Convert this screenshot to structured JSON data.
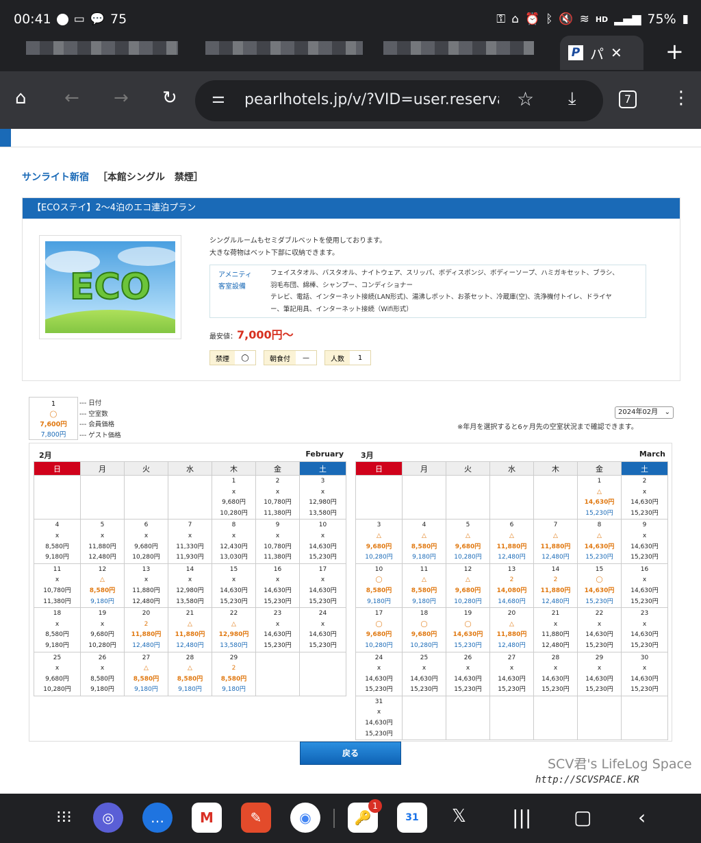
{
  "status": {
    "time": "00:41",
    "notif_count": "75",
    "battery": "75%",
    "hd": "HD"
  },
  "tab": {
    "title": "パ",
    "fav": "P",
    "close": "✕",
    "new": "+"
  },
  "toolbar": {
    "url": "pearlhotels.jp/v/?VID=user.reservat",
    "tabs": "7"
  },
  "hotel": {
    "name": "サンライト新宿",
    "room": "［本館シングル　禁煙］"
  },
  "plan": {
    "title": "【ECOステイ】2〜4泊のエコ連泊プラン",
    "image_text": "ECO",
    "desc1": "シングルルームもセミダブルベットを使用しております。",
    "desc2": "大きな荷物はベット下部に収納できます。",
    "amen_label1": "アメニティ",
    "amen_label2": "客室設備",
    "amen_line1": "フェイスタオル、バスタオル、ナイトウェア、スリッパ、ボディスポンジ、ボディーソープ、ハミガキセット、ブラシ、",
    "amen_line2": "羽毛布団、綿棒、シャンプー、コンディショナー",
    "amen_line3": "テレビ、電話、インターネット接続(LAN形式)、湯沸しポット、お茶セット、冷蔵庫(空)、洗浄機付トイレ、ドライヤ",
    "amen_line4": "ー、筆記用具、インターネット接続（Wifi形式）",
    "price_label": "最安値：",
    "price": "7,000円〜",
    "tags": [
      {
        "k": "禁煙",
        "v": "◯"
      },
      {
        "k": "朝食付",
        "v": "—"
      },
      {
        "k": "人数",
        "v": "1"
      }
    ]
  },
  "legend": {
    "day": "1",
    "avail": "◯",
    "member": "7,600円",
    "guest": "7,800円",
    "l1": "--- 日付",
    "l2": "--- 空室数",
    "l3": "--- 会員価格",
    "l4": "--- ゲスト価格"
  },
  "month_select": "2024年02月",
  "note": "※年月を選択すると6ヶ月先の空室状況まで確認できます。",
  "weekdays": [
    "日",
    "月",
    "火",
    "水",
    "木",
    "金",
    "土"
  ],
  "calendars": [
    {
      "ja": "2月",
      "en": "February",
      "weeks": [
        [
          null,
          null,
          null,
          null,
          {
            "d": "1",
            "a": "x",
            "m": "9,680円",
            "g": "10,280円",
            "o": false
          },
          {
            "d": "2",
            "a": "x",
            "m": "10,780円",
            "g": "11,380円",
            "o": false
          },
          {
            "d": "3",
            "a": "x",
            "m": "12,980円",
            "g": "13,580円",
            "o": false
          }
        ],
        [
          {
            "d": "4",
            "a": "x",
            "m": "8,580円",
            "g": "9,180円",
            "o": false
          },
          {
            "d": "5",
            "a": "x",
            "m": "11,880円",
            "g": "12,480円",
            "o": false
          },
          {
            "d": "6",
            "a": "x",
            "m": "9,680円",
            "g": "10,280円",
            "o": false
          },
          {
            "d": "7",
            "a": "x",
            "m": "11,330円",
            "g": "11,930円",
            "o": false
          },
          {
            "d": "8",
            "a": "x",
            "m": "12,430円",
            "g": "13,030円",
            "o": false
          },
          {
            "d": "9",
            "a": "x",
            "m": "10,780円",
            "g": "11,380円",
            "o": false
          },
          {
            "d": "10",
            "a": "x",
            "m": "14,630円",
            "g": "15,230円",
            "o": false
          }
        ],
        [
          {
            "d": "11",
            "a": "x",
            "m": "10,780円",
            "g": "11,380円",
            "o": false
          },
          {
            "d": "12",
            "a": "△",
            "m": "8,580円",
            "g": "9,180円",
            "o": true
          },
          {
            "d": "13",
            "a": "x",
            "m": "11,880円",
            "g": "12,480円",
            "o": false
          },
          {
            "d": "14",
            "a": "x",
            "m": "12,980円",
            "g": "13,580円",
            "o": false
          },
          {
            "d": "15",
            "a": "x",
            "m": "14,630円",
            "g": "15,230円",
            "o": false
          },
          {
            "d": "16",
            "a": "x",
            "m": "14,630円",
            "g": "15,230円",
            "o": false
          },
          {
            "d": "17",
            "a": "x",
            "m": "14,630円",
            "g": "15,230円",
            "o": false
          }
        ],
        [
          {
            "d": "18",
            "a": "x",
            "m": "8,580円",
            "g": "9,180円",
            "o": false
          },
          {
            "d": "19",
            "a": "x",
            "m": "9,680円",
            "g": "10,280円",
            "o": false
          },
          {
            "d": "20",
            "a": "2",
            "m": "11,880円",
            "g": "12,480円",
            "o": true
          },
          {
            "d": "21",
            "a": "△",
            "m": "11,880円",
            "g": "12,480円",
            "o": true
          },
          {
            "d": "22",
            "a": "△",
            "m": "12,980円",
            "g": "13,580円",
            "o": true
          },
          {
            "d": "23",
            "a": "x",
            "m": "14,630円",
            "g": "15,230円",
            "o": false
          },
          {
            "d": "24",
            "a": "x",
            "m": "14,630円",
            "g": "15,230円",
            "o": false
          }
        ],
        [
          {
            "d": "25",
            "a": "x",
            "m": "9,680円",
            "g": "10,280円",
            "o": false
          },
          {
            "d": "26",
            "a": "x",
            "m": "8,580円",
            "g": "9,180円",
            "o": false
          },
          {
            "d": "27",
            "a": "△",
            "m": "8,580円",
            "g": "9,180円",
            "o": true
          },
          {
            "d": "28",
            "a": "△",
            "m": "8,580円",
            "g": "9,180円",
            "o": true
          },
          {
            "d": "29",
            "a": "2",
            "m": "8,580円",
            "g": "9,180円",
            "o": true
          },
          null,
          null
        ]
      ]
    },
    {
      "ja": "3月",
      "en": "March",
      "weeks": [
        [
          null,
          null,
          null,
          null,
          null,
          {
            "d": "1",
            "a": "△",
            "m": "14,630円",
            "g": "15,230円",
            "o": true
          },
          {
            "d": "2",
            "a": "x",
            "m": "14,630円",
            "g": "15,230円",
            "o": false
          }
        ],
        [
          {
            "d": "3",
            "a": "△",
            "m": "9,680円",
            "g": "10,280円",
            "o": true
          },
          {
            "d": "4",
            "a": "△",
            "m": "8,580円",
            "g": "9,180円",
            "o": true
          },
          {
            "d": "5",
            "a": "△",
            "m": "9,680円",
            "g": "10,280円",
            "o": true
          },
          {
            "d": "6",
            "a": "△",
            "m": "11,880円",
            "g": "12,480円",
            "o": true
          },
          {
            "d": "7",
            "a": "△",
            "m": "11,880円",
            "g": "12,480円",
            "o": true
          },
          {
            "d": "8",
            "a": "△",
            "m": "14,630円",
            "g": "15,230円",
            "o": true
          },
          {
            "d": "9",
            "a": "x",
            "m": "14,630円",
            "g": "15,230円",
            "o": false
          }
        ],
        [
          {
            "d": "10",
            "a": "◯",
            "m": "8,580円",
            "g": "9,180円",
            "o": true
          },
          {
            "d": "11",
            "a": "△",
            "m": "8,580円",
            "g": "9,180円",
            "o": true
          },
          {
            "d": "12",
            "a": "△",
            "m": "9,680円",
            "g": "10,280円",
            "o": true
          },
          {
            "d": "13",
            "a": "2",
            "m": "14,080円",
            "g": "14,680円",
            "o": true
          },
          {
            "d": "14",
            "a": "2",
            "m": "11,880円",
            "g": "12,480円",
            "o": true
          },
          {
            "d": "15",
            "a": "◯",
            "m": "14,630円",
            "g": "15,230円",
            "o": true
          },
          {
            "d": "16",
            "a": "x",
            "m": "14,630円",
            "g": "15,230円",
            "o": false
          }
        ],
        [
          {
            "d": "17",
            "a": "◯",
            "m": "9,680円",
            "g": "10,280円",
            "o": true
          },
          {
            "d": "18",
            "a": "◯",
            "m": "9,680円",
            "g": "10,280円",
            "o": true
          },
          {
            "d": "19",
            "a": "◯",
            "m": "14,630円",
            "g": "15,230円",
            "o": true
          },
          {
            "d": "20",
            "a": "△",
            "m": "11,880円",
            "g": "12,480円",
            "o": true
          },
          {
            "d": "21",
            "a": "x",
            "m": "11,880円",
            "g": "12,480円",
            "o": false
          },
          {
            "d": "22",
            "a": "x",
            "m": "14,630円",
            "g": "15,230円",
            "o": false
          },
          {
            "d": "23",
            "a": "x",
            "m": "14,630円",
            "g": "15,230円",
            "o": false
          }
        ],
        [
          {
            "d": "24",
            "a": "x",
            "m": "14,630円",
            "g": "15,230円",
            "o": false
          },
          {
            "d": "25",
            "a": "x",
            "m": "14,630円",
            "g": "15,230円",
            "o": false
          },
          {
            "d": "26",
            "a": "x",
            "m": "14,630円",
            "g": "15,230円",
            "o": false
          },
          {
            "d": "27",
            "a": "x",
            "m": "14,630円",
            "g": "15,230円",
            "o": false
          },
          {
            "d": "28",
            "a": "x",
            "m": "14,630円",
            "g": "15,230円",
            "o": false
          },
          {
            "d": "29",
            "a": "x",
            "m": "14,630円",
            "g": "15,230円",
            "o": false
          },
          {
            "d": "30",
            "a": "x",
            "m": "14,630円",
            "g": "15,230円",
            "o": false
          }
        ],
        [
          {
            "d": "31",
            "a": "x",
            "m": "14,630円",
            "g": "15,230円",
            "o": false
          },
          null,
          null,
          null,
          null,
          null,
          null
        ]
      ]
    }
  ],
  "back_button": "戻る",
  "watermark1": "SCV君's LifeLog Space",
  "watermark2": "http://SCVSPACE.KR",
  "dock": {
    "calendar_day": "31",
    "badge": "1"
  }
}
